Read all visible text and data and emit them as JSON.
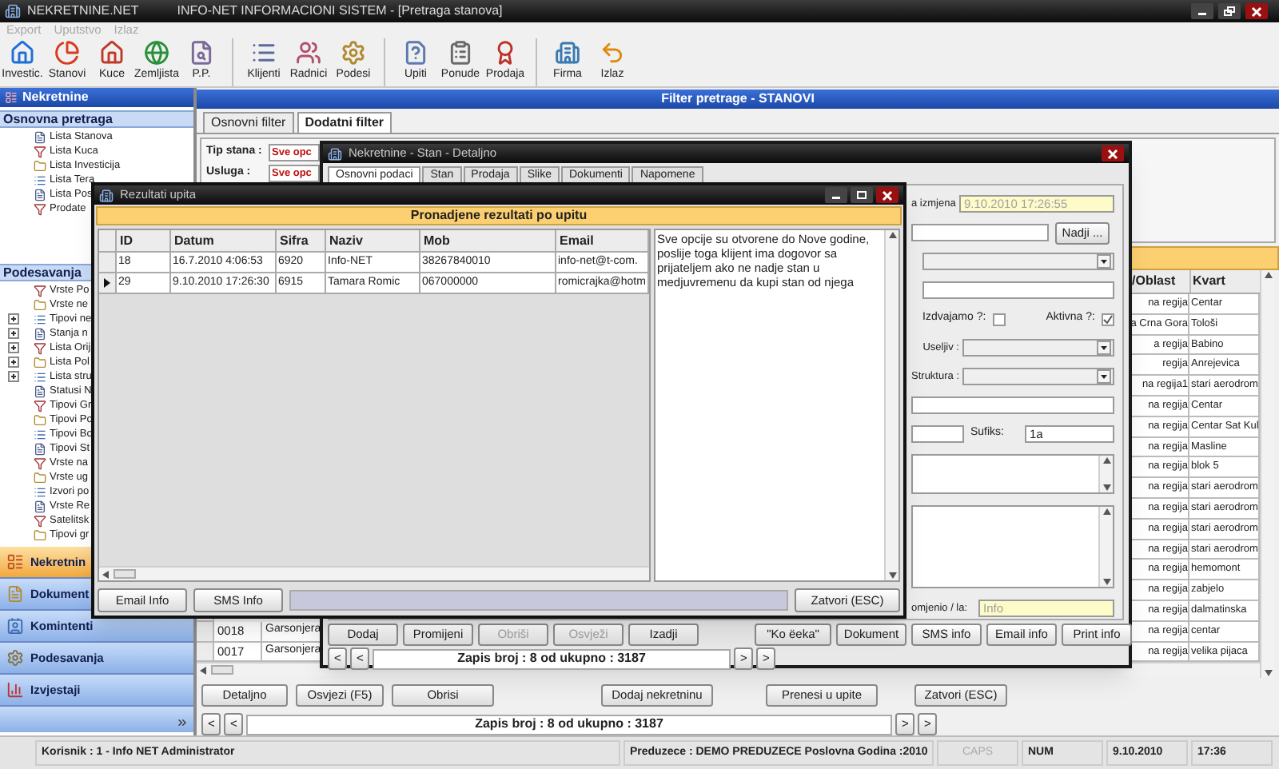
{
  "window": {
    "app_name": "NEKRETNINE.NET",
    "title": "INFO-NET INFORMACIONI SISTEM - [Pretraga stanova]"
  },
  "menu": [
    {
      "label": "Export",
      "disabled": true
    },
    {
      "label": "Uputstvo",
      "disabled": true
    },
    {
      "label": "Izlaz",
      "disabled": true
    }
  ],
  "toolbar": [
    {
      "items": [
        {
          "label": "Investic."
        },
        {
          "label": "Stanovi"
        },
        {
          "label": "Kuce"
        },
        {
          "label": "Zemljista"
        },
        {
          "label": "P.P."
        }
      ]
    },
    {
      "items": [
        {
          "label": "Klijenti"
        },
        {
          "label": "Radnici"
        },
        {
          "label": "Podesi"
        }
      ]
    },
    {
      "items": [
        {
          "label": "Upiti"
        },
        {
          "label": "Ponude"
        },
        {
          "label": "Prodaja"
        }
      ]
    },
    {
      "items": [
        {
          "label": "Firma"
        },
        {
          "label": "Izlaz"
        }
      ]
    }
  ],
  "sidebar": {
    "title": "Nekretnine",
    "sections": [
      {
        "title": "Osnovna pretraga",
        "items": [
          {
            "label": "Lista Stanova",
            "kind": "leaf"
          },
          {
            "label": "Lista Kuca",
            "kind": "leaf"
          },
          {
            "label": "Lista Investicija",
            "kind": "leaf"
          },
          {
            "label": "Lista Tera",
            "kind": "leaf"
          },
          {
            "label": "Lista Pos",
            "kind": "leaf"
          },
          {
            "label": "Prodate",
            "kind": "leaf"
          }
        ]
      },
      {
        "title": "Podesavanja",
        "items": [
          {
            "label": "Vrste Po",
            "kind": "leaf"
          },
          {
            "label": "Vrste ne",
            "kind": "leaf"
          },
          {
            "label": "Tipovi ne",
            "kind": "group"
          },
          {
            "label": "Stanja n",
            "kind": "group"
          },
          {
            "label": "Lista Orij",
            "kind": "group"
          },
          {
            "label": "Lista Pol",
            "kind": "group"
          },
          {
            "label": "Lista stru",
            "kind": "group"
          },
          {
            "label": "Statusi N",
            "kind": "leaf"
          },
          {
            "label": "Tipovi Gr",
            "kind": "leaf"
          },
          {
            "label": "Tipovi Po",
            "kind": "leaf"
          },
          {
            "label": "Tipovi Bo",
            "kind": "leaf"
          },
          {
            "label": "Tipovi St",
            "kind": "leaf"
          },
          {
            "label": "Vrste na",
            "kind": "leaf"
          },
          {
            "label": "Vrste ug",
            "kind": "leaf"
          },
          {
            "label": "Izvori po",
            "kind": "leaf"
          },
          {
            "label": "Vrste Re",
            "kind": "leaf"
          },
          {
            "label": "Satelitsk",
            "kind": "leaf"
          },
          {
            "label": "Tipovi gr",
            "kind": "leaf"
          }
        ]
      }
    ],
    "nav": [
      {
        "label": "Nekretnin",
        "selected": true
      },
      {
        "label": "Dokument",
        "selected": false
      },
      {
        "label": "Komintenti",
        "selected": false
      },
      {
        "label": "Podesavanja",
        "selected": false
      },
      {
        "label": "Izvjestaji",
        "selected": false
      }
    ]
  },
  "main": {
    "title": "Filter pretrage - STANOVI",
    "tabs": [
      {
        "label": "Osnovni filter",
        "selected": false
      },
      {
        "label": "Dodatni filter",
        "selected": true
      }
    ],
    "filters": [
      {
        "label": "Tip stana :",
        "value": "Sve opc"
      },
      {
        "label": "Usluga :",
        "value": "Sve opc"
      }
    ],
    "table": {
      "columns": [
        "/Oblast",
        "Kvart"
      ],
      "rows": [
        {
          "oblast": "na regija",
          "kvart": "Centar"
        },
        {
          "oblast": "a Crna Gora",
          "kvart": "Tološi"
        },
        {
          "oblast": "a regija",
          "kvart": "Babino"
        },
        {
          "oblast": "regija",
          "kvart": "Anrejevica"
        },
        {
          "oblast": "na regija1",
          "kvart": "stari aerodrom"
        },
        {
          "oblast": "na regija",
          "kvart": "Centar"
        },
        {
          "oblast": "na regija",
          "kvart": "Centar Sat Kul"
        },
        {
          "oblast": "na regija",
          "kvart": "Masline"
        },
        {
          "oblast": "na regija",
          "kvart": "blok 5"
        },
        {
          "oblast": "na regija",
          "kvart": "stari aerodrom"
        },
        {
          "oblast": "na regija",
          "kvart": "stari aerodrom"
        },
        {
          "oblast": "na regija",
          "kvart": "stari aerodrom"
        },
        {
          "oblast": "na regija",
          "kvart": "stari aerodrom"
        },
        {
          "oblast": "na regija",
          "kvart": "hemomont"
        },
        {
          "oblast": "na regija",
          "kvart": "zabjelo"
        },
        {
          "oblast": "na regija",
          "kvart": "dalmatinska"
        },
        {
          "column_1": "0018",
          "column_2": "Garsonjera",
          "oblast": "na regija",
          "kvart": "centar"
        },
        {
          "column_1": "0017",
          "column_2": "Garsonjera",
          "oblast": "na regija",
          "kvart": "velika pijaca"
        }
      ]
    },
    "buttons": [
      "Detaljno",
      "Osvjezi (F5)",
      "Obrisi",
      "Dodaj nekretninu",
      "Prenesi u upite",
      "Zatvori (ESC)"
    ],
    "pager": {
      "prev": [
        "<",
        "<"
      ],
      "record": "Zapis broj : 8 od ukupno : 3187",
      "next": [
        ">",
        ">"
      ]
    }
  },
  "detail": {
    "title": "Nekretnine - Stan - Detaljno",
    "tabs": [
      {
        "label": "Osnovni podaci",
        "selected": true
      },
      {
        "label": "Stan",
        "selected": false
      },
      {
        "label": "Prodaja",
        "selected": false
      },
      {
        "label": "Slike",
        "selected": false
      },
      {
        "label": "Dokumenti",
        "selected": false
      },
      {
        "label": "Napomene",
        "selected": false
      }
    ],
    "date_changed": {
      "label": "a izmjena",
      "value": "9.10.2010 17:26:55"
    },
    "find_button": "Nadji ...",
    "flags": [
      {
        "label": "Izdvajamo ?:",
        "checked": false
      },
      {
        "label": "Aktivna ?:",
        "checked": true
      }
    ],
    "selects": [
      {
        "label": "Useljiv :"
      },
      {
        "label": "Struktura :"
      }
    ],
    "suffix": {
      "label": "Sufiks:",
      "value": "1a"
    },
    "changed_by": {
      "label": "omjenio / la:",
      "value": "Info"
    },
    "buttons": [
      {
        "label": "Dodaj",
        "disabled": false
      },
      {
        "label": "Promijeni",
        "disabled": false
      },
      {
        "label": "Obriši",
        "disabled": true
      },
      {
        "label": "Osvježi",
        "disabled": true
      },
      {
        "label": "Izadji",
        "disabled": false
      },
      {
        "label": "\"Ko ëeka\"",
        "disabled": false
      },
      {
        "label": "Dokument",
        "disabled": false
      },
      {
        "label": "SMS info",
        "disabled": false
      },
      {
        "label": "Email info",
        "disabled": false
      },
      {
        "label": "Print info",
        "disabled": false
      }
    ],
    "pager": {
      "prev": [
        "<",
        "<"
      ],
      "record": "Zapis broj : 8 od ukupno : 3187",
      "next": [
        ">",
        ">"
      ]
    }
  },
  "results": {
    "title": "Rezultati upita",
    "heading": "Pronadjene rezultati po upitu",
    "columns": [
      "ID",
      "Datum",
      "Sifra",
      "Naziv",
      "Mob",
      "Email"
    ],
    "rows": [
      {
        "selected": false,
        "cells": [
          "18",
          "16.7.2010 4:06:53",
          "6920",
          "Info-NET",
          "38267840010",
          "info-net@t-com."
        ]
      },
      {
        "selected": true,
        "cells": [
          "29",
          "9.10.2010 17:26:30",
          "6915",
          "Tamara Romic",
          "067000000",
          "romicrajka@hotm"
        ]
      }
    ],
    "note": "Sve opcije su otvorene do Nove godine, poslije toga klijent ima dogovor sa prijateljem ako ne nadje stan u medjuvremenu da kupi stan od njega",
    "buttons": [
      "Email Info",
      "SMS Info"
    ],
    "close_button": "Zatvori (ESC)"
  },
  "status_bar": {
    "user": "Korisnik : 1 - Info NET  Administrator",
    "company": "Preduzece : DEMO PREDUZECE   Poslovna Godina :2010",
    "indicators": [
      {
        "label": "CAPS",
        "on": false
      },
      {
        "label": "NUM",
        "on": true
      }
    ],
    "date": "9.10.2010",
    "time": "17:36"
  }
}
